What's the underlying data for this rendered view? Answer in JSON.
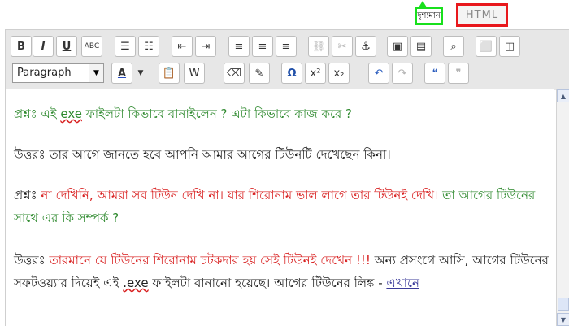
{
  "tabs": {
    "visual": "দৃশ্যমান",
    "html": "HTML"
  },
  "toolbar": {
    "row1": [
      {
        "name": "bold-button",
        "glyph": "B"
      },
      {
        "name": "italic-button",
        "glyph": "I"
      },
      {
        "name": "underline-button",
        "glyph": "U"
      },
      {
        "name": "strikethrough-button",
        "glyph": "ABC"
      },
      {
        "name": "bullet-list-button",
        "glyph": "☰"
      },
      {
        "name": "numbered-list-button",
        "glyph": "☷"
      },
      {
        "name": "outdent-button",
        "glyph": "⇤"
      },
      {
        "name": "indent-button",
        "glyph": "⇥"
      },
      {
        "name": "align-left-button",
        "glyph": "≡"
      },
      {
        "name": "align-center-button",
        "glyph": "≡"
      },
      {
        "name": "align-right-button",
        "glyph": "≡"
      },
      {
        "name": "link-button",
        "glyph": "⛓"
      },
      {
        "name": "unlink-button",
        "glyph": "✂"
      },
      {
        "name": "anchor-button",
        "glyph": "⚓"
      },
      {
        "name": "insert-image-button",
        "glyph": "▣"
      },
      {
        "name": "insert-media-button",
        "glyph": "▤"
      },
      {
        "name": "find-button",
        "glyph": "⌕"
      },
      {
        "name": "fullscreen-button",
        "glyph": "⬜"
      },
      {
        "name": "source-view-button",
        "glyph": "◫"
      }
    ],
    "row2": {
      "format_select": "Paragraph",
      "buttons": [
        {
          "name": "text-color-button",
          "glyph": "A"
        },
        {
          "name": "paste-button",
          "glyph": "📋"
        },
        {
          "name": "paste-word-button",
          "glyph": "W"
        },
        {
          "name": "eraser-button",
          "glyph": "⌫"
        },
        {
          "name": "clean-button",
          "glyph": "✎"
        },
        {
          "name": "omega-button",
          "glyph": "Ω"
        },
        {
          "name": "superscript-button",
          "glyph": "x²"
        },
        {
          "name": "subscript-button",
          "glyph": "x₂"
        },
        {
          "name": "undo-button",
          "glyph": "↶"
        },
        {
          "name": "redo-button",
          "glyph": "↷"
        },
        {
          "name": "blockquote-button",
          "glyph": "❝"
        },
        {
          "name": "unquote-button",
          "glyph": "❞"
        }
      ]
    }
  },
  "content": {
    "p1": {
      "a": "প্রশ্নঃ এই ",
      "b": "exe",
      "c": " ফাইলটা কিভাবে বানাইলেন ? এটা কিভাবে কাজ করে ?"
    },
    "p2": "উত্তরঃ তার আগে জানতে হবে আপনি আমার আগের টিউনটি দেখেছেন কিনা।",
    "p3": {
      "label": "প্রশ্নঃ ",
      "red": "না দেখিনি, আমরা  সব টিউন দেখি না। যার শিরোনাম ভাল লাগে তার টিউনই দেখি।",
      "green": " তা আগের টিউনের সাথে এর কি সম্পর্ক ?"
    },
    "p4": {
      "label": "উত্তরঃ ",
      "red": "তারমানে যে টিউনের শিরোনাম চটকদার হয় সেই টিউনই দেখেন !!!",
      "dark1": " অন্য প্রসংগে আসি, আগের টিউনের সফটওয়্যার দিয়েই এই ",
      "exe": ".exe",
      "dark2": " ফাইলটা  বানানো হয়েছে। আগের টিউনের লিঙ্ক - ",
      "link": "এখানে"
    }
  },
  "colors": {
    "visual_tab_border": "#18e01c",
    "html_tab_border": "#e8181c",
    "green_text": "#2f8a2f",
    "red_text": "#d81f1f",
    "link": "#3b3b9a"
  }
}
